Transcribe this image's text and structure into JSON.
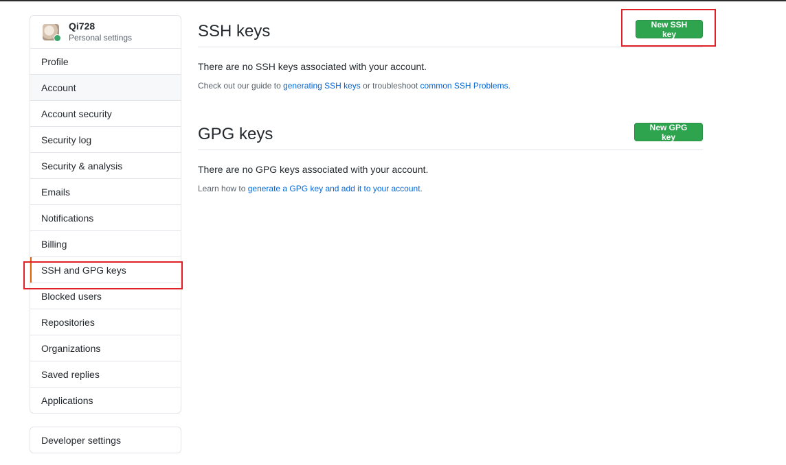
{
  "profile": {
    "name": "Qi728",
    "subtitle": "Personal settings",
    "avatar_icon": "avatar-image"
  },
  "sidebar": {
    "items": [
      {
        "label": "Profile"
      },
      {
        "label": "Account"
      },
      {
        "label": "Account security"
      },
      {
        "label": "Security log"
      },
      {
        "label": "Security & analysis"
      },
      {
        "label": "Emails"
      },
      {
        "label": "Notifications"
      },
      {
        "label": "Billing"
      },
      {
        "label": "SSH and GPG keys"
      },
      {
        "label": "Blocked users"
      },
      {
        "label": "Repositories"
      },
      {
        "label": "Organizations"
      },
      {
        "label": "Saved replies"
      },
      {
        "label": "Applications"
      }
    ],
    "developer_settings": "Developer settings"
  },
  "ssh": {
    "title": "SSH keys",
    "button": "New SSH key",
    "empty": "There are no SSH keys associated with your account.",
    "help_prefix": "Check out our guide to ",
    "help_link1": "generating SSH keys",
    "help_middle": " or troubleshoot ",
    "help_link2": "common SSH Problems",
    "help_suffix": "."
  },
  "gpg": {
    "title": "GPG keys",
    "button": "New GPG key",
    "empty": "There are no GPG keys associated with your account.",
    "help_prefix": "Learn how to ",
    "help_link": "generate a GPG key and add it to your account",
    "help_suffix": "."
  },
  "colors": {
    "accent_green": "#2ea44f",
    "link_blue": "#0366d6",
    "selected_marker": "#e36209",
    "annotation_red": "#e01f26"
  }
}
